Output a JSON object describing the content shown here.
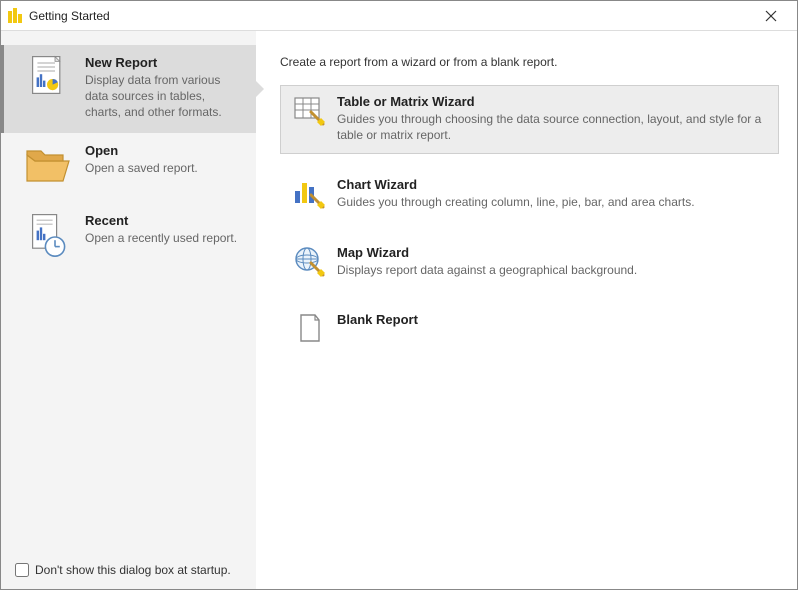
{
  "window": {
    "title": "Getting Started"
  },
  "sidebar": {
    "items": [
      {
        "title": "New Report",
        "desc": "Display data from various data sources in tables, charts, and other formats."
      },
      {
        "title": "Open",
        "desc": "Open a saved report."
      },
      {
        "title": "Recent",
        "desc": "Open a recently used report."
      }
    ],
    "footer": {
      "label": "Don't show this dialog box at startup."
    }
  },
  "main": {
    "header": "Create a report from a wizard or from a blank report.",
    "options": [
      {
        "title": "Table or Matrix Wizard",
        "desc": "Guides you through choosing the data source connection, layout, and style for a table or matrix report."
      },
      {
        "title": "Chart Wizard",
        "desc": "Guides you through creating column, line, pie, bar, and area charts."
      },
      {
        "title": "Map Wizard",
        "desc": "Displays report data against a geographical background."
      },
      {
        "title": "Blank Report",
        "desc": ""
      }
    ]
  }
}
